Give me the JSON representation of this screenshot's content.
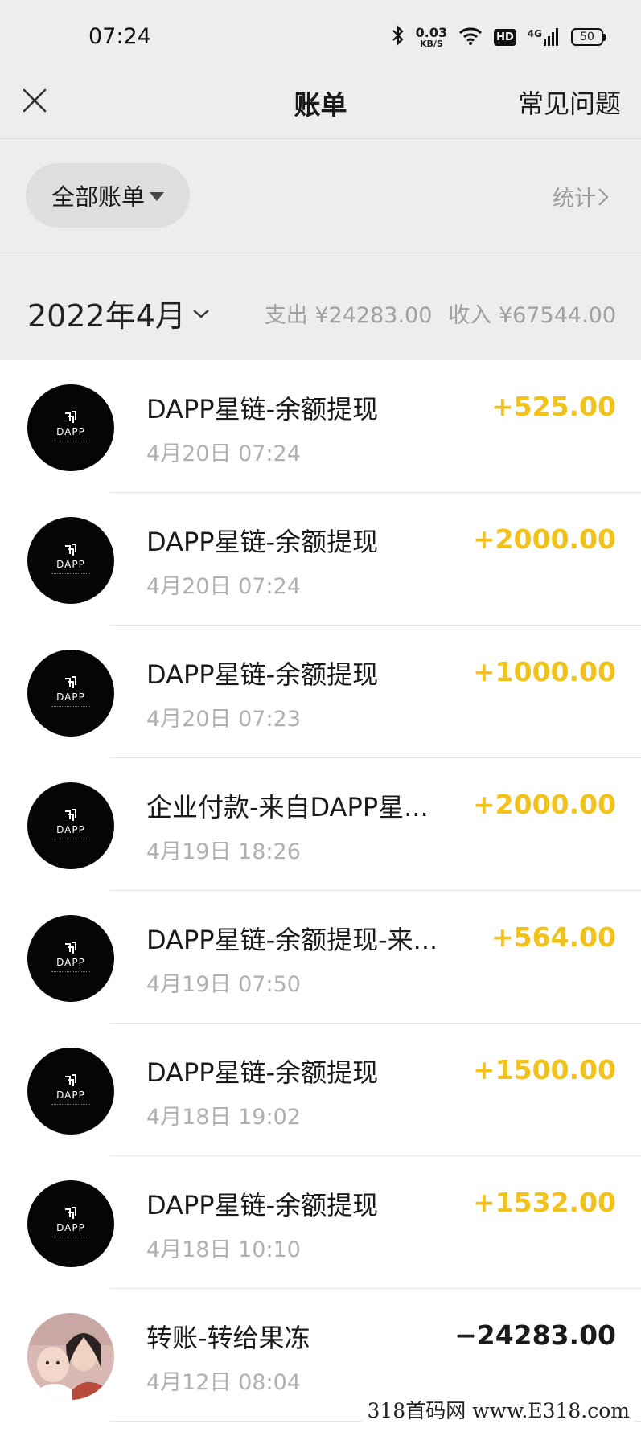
{
  "status_bar": {
    "time": "07:24",
    "net_speed_value": "0.03",
    "net_speed_unit": "KB/S",
    "hd_label": "HD",
    "network_label": "4G",
    "battery": "50",
    "icons": [
      "bluetooth-icon",
      "wifi-icon",
      "signal-icon",
      "battery-icon"
    ]
  },
  "nav": {
    "title": "账单",
    "faq_label": "常见问题",
    "close_icon": "close-icon"
  },
  "filter": {
    "label": "全部账单",
    "stats_label": "统计"
  },
  "month": {
    "label": "2022年4月",
    "expense_label": "支出 ¥24283.00",
    "income_label": "收入 ¥67544.00"
  },
  "colors": {
    "income_amount": "#f2c21b",
    "expense_amount": "#1a1a1a",
    "header_bg": "#ededed"
  },
  "bills": [
    {
      "title": "DAPP星链-余额提现",
      "datetime": "4月20日 07:24",
      "amount": "+525.00",
      "avatar": "DAPP",
      "negative": false
    },
    {
      "title": "DAPP星链-余额提现",
      "datetime": "4月20日 07:24",
      "amount": "+2000.00",
      "avatar": "DAPP",
      "negative": false
    },
    {
      "title": "DAPP星链-余额提现",
      "datetime": "4月20日 07:23",
      "amount": "+1000.00",
      "avatar": "DAPP",
      "negative": false
    },
    {
      "title": "企业付款-来自DAPP星...",
      "datetime": "4月19日 18:26",
      "amount": "+2000.00",
      "avatar": "DAPP",
      "negative": false
    },
    {
      "title": "DAPP星链-余额提现-来...",
      "datetime": "4月19日 07:50",
      "amount": "+564.00",
      "avatar": "DAPP",
      "negative": false
    },
    {
      "title": "DAPP星链-余额提现",
      "datetime": "4月18日 19:02",
      "amount": "+1500.00",
      "avatar": "DAPP",
      "negative": false
    },
    {
      "title": "DAPP星链-余额提现",
      "datetime": "4月18日 10:10",
      "amount": "+1532.00",
      "avatar": "DAPP",
      "negative": false
    },
    {
      "title": "转账-转给果冻",
      "datetime": "4月12日 08:04",
      "amount": "−24283.00",
      "avatar": "photo",
      "negative": true
    }
  ],
  "watermark": "318首码网 www.E318.com"
}
